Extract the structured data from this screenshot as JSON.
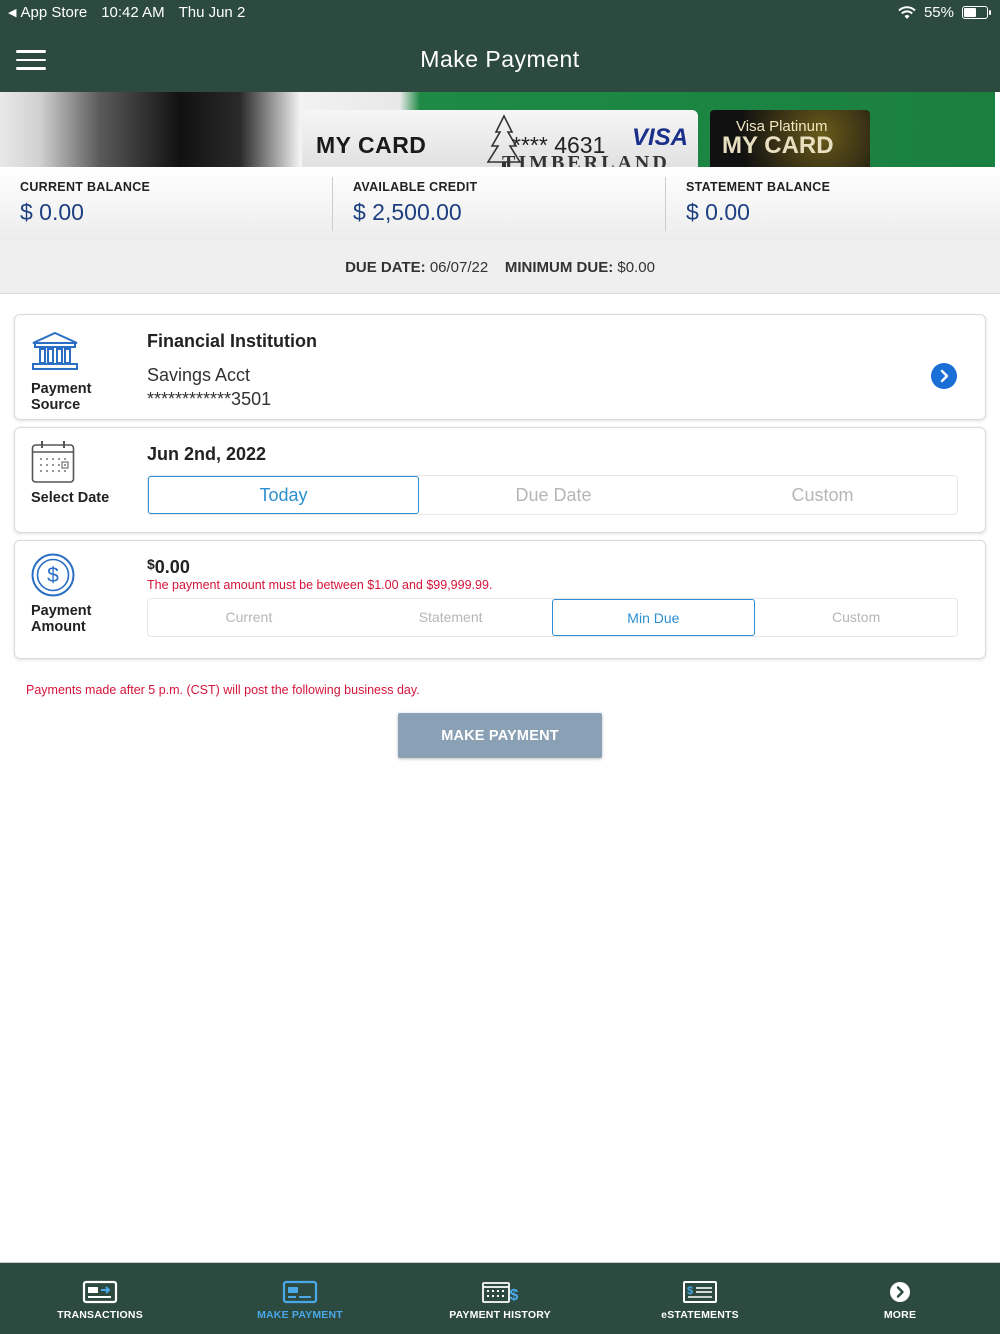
{
  "status_bar": {
    "back_app": "App Store",
    "time": "10:42 AM",
    "date": "Thu Jun 2",
    "battery": "55%",
    "battery_level": 0.55
  },
  "header": {
    "title": "Make Payment"
  },
  "cards": {
    "main": {
      "name": "MY CARD",
      "number": "**** 4631",
      "brand": "VISA",
      "issuer": "TIMBERLAND"
    },
    "alt": {
      "subtitle": "Visa Platinum",
      "name": "MY CARD"
    }
  },
  "balances": [
    {
      "label": "CURRENT BALANCE",
      "value": "$ 0.00"
    },
    {
      "label": "AVAILABLE CREDIT",
      "value": "$ 2,500.00"
    },
    {
      "label": "STATEMENT BALANCE",
      "value": "$ 0.00"
    }
  ],
  "due": {
    "due_date_label": "DUE DATE:",
    "due_date_value": "06/07/22",
    "min_due_label": "MINIMUM DUE:",
    "min_due_value": "$0.00"
  },
  "payment_source": {
    "label_line1": "Payment",
    "label_line2": "Source",
    "title": "Financial Institution",
    "account_name": "Savings Acct",
    "account_number": "************3501",
    "icon": "bank-icon"
  },
  "select_date": {
    "label": "Select Date",
    "value": "Jun 2nd, 2022",
    "options": [
      "Today",
      "Due Date",
      "Custom"
    ],
    "selected": "Today",
    "icon": "calendar-icon"
  },
  "payment_amount": {
    "label_line1": "Payment",
    "label_line2": "Amount",
    "currency": "$",
    "value": "0.00",
    "error": "The payment amount must be between $1.00 and $99,999.99.",
    "options": [
      "Current",
      "Statement",
      "Min Due",
      "Custom"
    ],
    "selected": "Min Due",
    "icon": "dollar-icon"
  },
  "notice": "Payments made after 5 p.m. (CST) will post the following business day.",
  "make_payment_label": "MAKE PAYMENT",
  "tabs": [
    {
      "label": "TRANSACTIONS",
      "icon": "transactions-icon",
      "active": false
    },
    {
      "label": "MAKE PAYMENT",
      "icon": "make-payment-icon",
      "active": true
    },
    {
      "label": "PAYMENT HISTORY",
      "icon": "payment-history-icon",
      "active": false
    },
    {
      "label": "eSTATEMENTS",
      "icon": "estatements-icon",
      "active": false
    },
    {
      "label": "MORE",
      "icon": "more-icon",
      "active": false
    }
  ],
  "colors": {
    "header_bg": "#2c4a3f",
    "balance_value": "#1c3f80",
    "accent_blue": "#2c8fd0",
    "error_red": "#d4143a",
    "button_bg": "#8aa0b5",
    "active_tab": "#4aa8e8"
  }
}
